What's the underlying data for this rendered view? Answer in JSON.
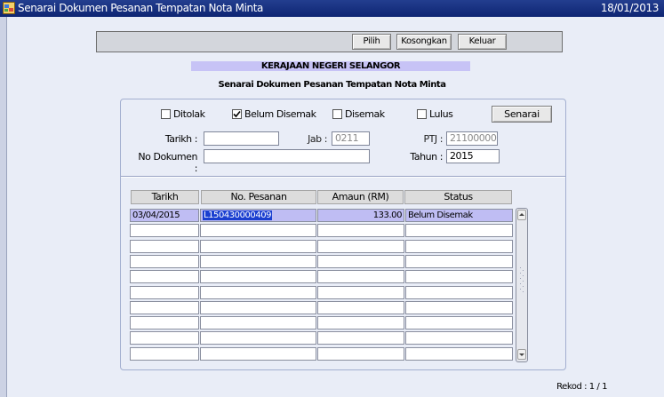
{
  "window": {
    "title": "Senarai Dokumen Pesanan Tempatan Nota Minta",
    "date": "18/01/2013"
  },
  "toolbar": {
    "pilih": "Pilih",
    "kosongkan": "Kosongkan",
    "keluar": "Keluar"
  },
  "header": {
    "agency": "KERAJAAN NEGERI SELANGOR",
    "subtitle": "Senarai Dokumen Pesanan Tempatan Nota Minta"
  },
  "filters": {
    "ditolak": {
      "label": "Ditolak",
      "checked": false
    },
    "belum_disemak": {
      "label": "Belum Disemak",
      "checked": true
    },
    "disemak": {
      "label": "Disemak",
      "checked": false
    },
    "lulus": {
      "label": "Lulus",
      "checked": false
    },
    "senarai_button": "Senarai"
  },
  "form": {
    "tarikh_label": "Tarikh :",
    "tarikh_value": "",
    "jab_label": "Jab :",
    "jab_value": "0211",
    "ptj_label": "PTJ :",
    "ptj_value": "21100000",
    "no_dokumen_label": "No Dokumen :",
    "no_dokumen_value": "",
    "tahun_label": "Tahun :",
    "tahun_value": "2015"
  },
  "grid": {
    "columns": [
      "Tarikh",
      "No. Pesanan",
      "Amaun (RM)",
      "Status"
    ],
    "rows": [
      {
        "tarikh": "03/04/2015",
        "no_pesanan": "L150430000409",
        "amaun": "133.00",
        "status": "Belum Disemak"
      },
      {
        "tarikh": "",
        "no_pesanan": "",
        "amaun": "",
        "status": ""
      },
      {
        "tarikh": "",
        "no_pesanan": "",
        "amaun": "",
        "status": ""
      },
      {
        "tarikh": "",
        "no_pesanan": "",
        "amaun": "",
        "status": ""
      },
      {
        "tarikh": "",
        "no_pesanan": "",
        "amaun": "",
        "status": ""
      },
      {
        "tarikh": "",
        "no_pesanan": "",
        "amaun": "",
        "status": ""
      },
      {
        "tarikh": "",
        "no_pesanan": "",
        "amaun": "",
        "status": ""
      },
      {
        "tarikh": "",
        "no_pesanan": "",
        "amaun": "",
        "status": ""
      },
      {
        "tarikh": "",
        "no_pesanan": "",
        "amaun": "",
        "status": ""
      },
      {
        "tarikh": "",
        "no_pesanan": "",
        "amaun": "",
        "status": ""
      }
    ]
  },
  "footer": {
    "rekod": "Rekod : 1 / 1"
  },
  "colors": {
    "titlebar": "#0e2573",
    "selected_row": "#bfbdf3",
    "text_highlight": "#1a3fd0",
    "header_strip": "#c7c3f6"
  }
}
